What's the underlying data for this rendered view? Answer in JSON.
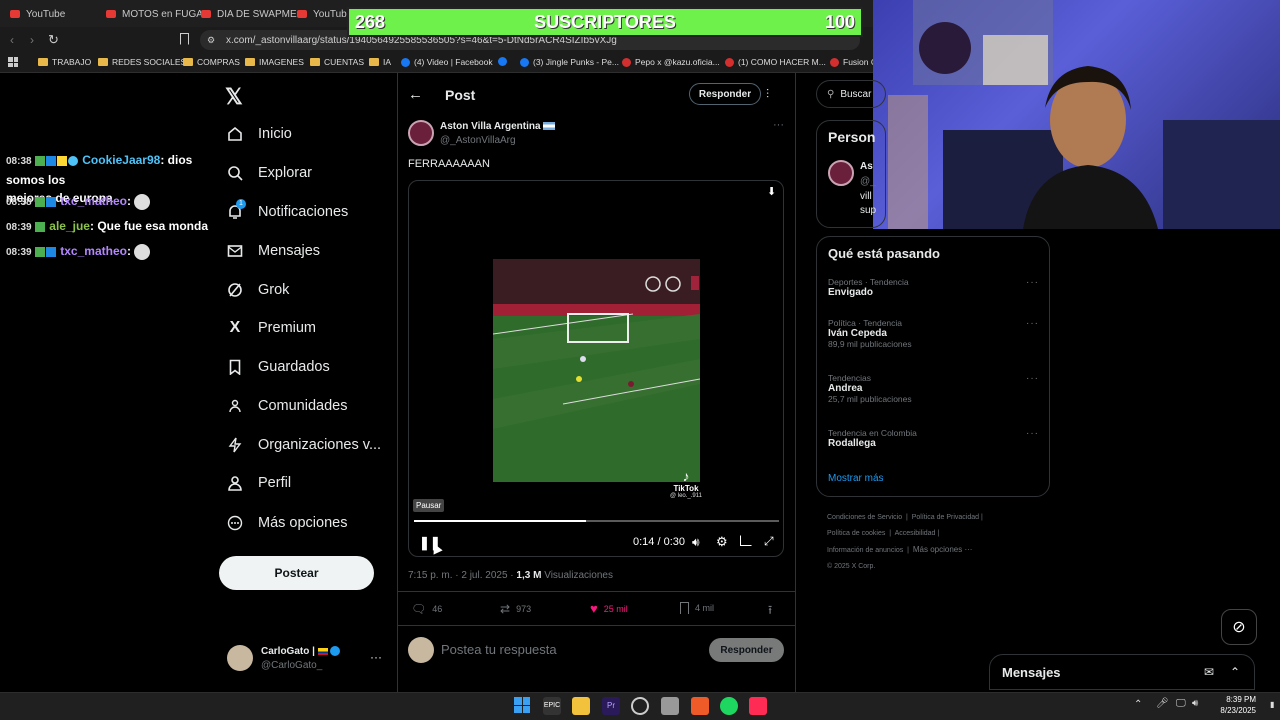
{
  "browser": {
    "tabs": [
      "YouTube",
      "MOTOS en FUGA",
      "DIA DE SWAPME",
      "YouTube"
    ],
    "url": "x.com/_astonvillaarg/status/1940564925585536505?s=46&t=5-DtNd5rACR4SIZIb5vXJg",
    "bookmarks": [
      "TRABAJO",
      "REDES SOCIALES",
      "COMPRAS",
      "IMAGENES",
      "CUENTAS",
      "IA",
      "(4) Video | Facebook",
      "(3) Jingle Punks - Pe...",
      "Pepo x @kazu.oficia...",
      "(1) COMO HACER M...",
      "Fusion Cl"
    ]
  },
  "overlay": {
    "left_count": "268",
    "label": "SUSCRIPTORES",
    "right_count": "100"
  },
  "chat": [
    {
      "time": "08:38",
      "user": "CookieJaar98",
      "user_color": "#4fc3f7",
      "message": "dios somos los",
      "message2": "mejores de europa"
    },
    {
      "time": "08:38",
      "user": "txc_matheo",
      "user_color": "#b388ff",
      "message": ""
    },
    {
      "time": "08:39",
      "user": "ale_jue",
      "user_color": "#8bc34a",
      "message": "Que fue esa monda"
    },
    {
      "time": "08:39",
      "user": "txc_matheo",
      "user_color": "#b388ff",
      "message": ""
    }
  ],
  "nav": {
    "items": [
      "Inicio",
      "Explorar",
      "Notificaciones",
      "Mensajes",
      "Grok",
      "Premium",
      "Guardados",
      "Comunidades",
      "Organizaciones v...",
      "Perfil",
      "Más opciones"
    ],
    "notif_badge": "1",
    "post_button": "Postear",
    "account_name": "CarloGato |",
    "account_handle": "@CarloGato_"
  },
  "post": {
    "header_title": "Post",
    "reply_button": "Responder",
    "author_name": "Aston Villa Argentina",
    "author_handle": "@_AstonVillaArg",
    "text": "FERRAAAAAAN",
    "video_tooltip": "Pausar",
    "video_time": "0:14 / 0:30",
    "video_progress": 0.47,
    "tiktok_label": "TikTok",
    "tiktok_user": "@ leo._.911",
    "timestamp": "7:15 p. m. · 2 jul. 2025 ·",
    "views_count": "1,3 M",
    "views_label": "Visualizaciones",
    "stats": {
      "replies": "46",
      "reposts": "973",
      "likes": "25 mil",
      "bookmarks": "4 mil"
    },
    "reply_placeholder": "Postea tu respuesta",
    "reply_submit": "Responder"
  },
  "sidebar": {
    "search_placeholder": "Buscar",
    "persons_title": "Person",
    "person_name": "As",
    "person_handle": "@_",
    "person_bio1": "vill",
    "person_bio2": "sup",
    "trending_title": "Qué está pasando",
    "trends": [
      {
        "category": "Deportes · Tendencia",
        "name": "Envigado",
        "count": ""
      },
      {
        "category": "Política · Tendencia",
        "name": "Iván Cepeda",
        "count": "89,9 mil publicaciones"
      },
      {
        "category": "Tendencias",
        "name": "Andrea",
        "count": "25,7 mil publicaciones"
      },
      {
        "category": "Tendencia en Colombia",
        "name": "Rodallega",
        "count": ""
      }
    ],
    "show_more": "Mostrar más",
    "footer": [
      "Condiciones de Servicio",
      "Política de Privacidad",
      "Política de cookies",
      "Accesibilidad",
      "Información de anuncios",
      "Más opciones ···",
      "© 2025 X Corp."
    ],
    "messages_title": "Mensajes"
  },
  "taskbar": {
    "time": "8:39 PM",
    "date": "8/23/2025"
  }
}
